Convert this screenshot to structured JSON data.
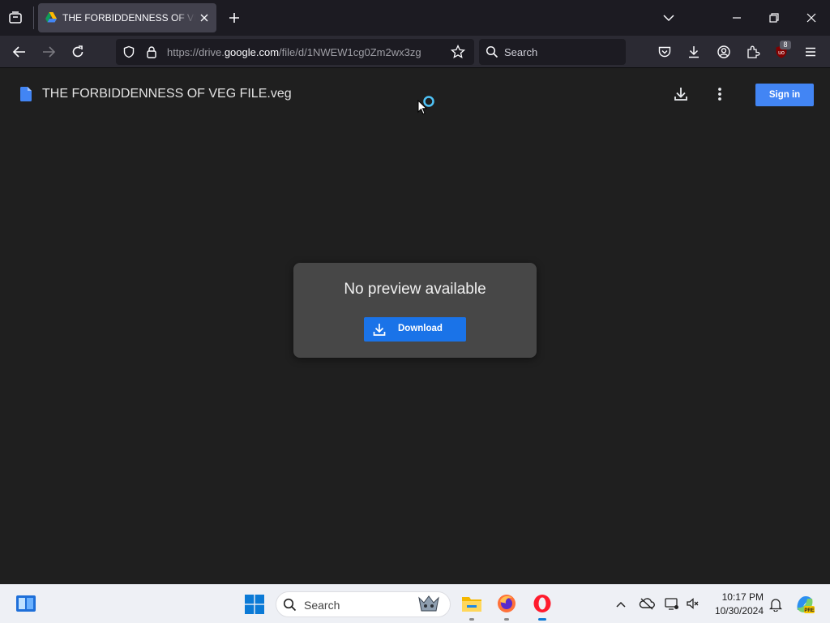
{
  "browser": {
    "tab_title": "THE FORBIDDENNESS OF VEG FILE.veg",
    "url_prefix": "https://drive.",
    "url_host": "google.com",
    "url_rest": "/file/d/1NWEW1cg0Zm2wx3zg",
    "search_placeholder": "Search",
    "extension_badge_count": "8"
  },
  "drive": {
    "file_title": "THE FORBIDDENNESS OF VEG FILE.veg",
    "sign_in_label": "Sign in",
    "no_preview_text": "No preview available",
    "download_label": "Download"
  },
  "taskbar": {
    "search_placeholder": "Search",
    "time": "10:17 PM",
    "date": "10/30/2024"
  },
  "colors": {
    "page_bg": "#1f1f1f",
    "accent_blue": "#1a73e8",
    "signin_blue": "#4285f4",
    "card_bg": "#474747"
  },
  "icons": [
    "tab-overview-icon",
    "google-drive-icon",
    "close-tab-icon",
    "new-tab-icon",
    "list-all-tabs-icon",
    "minimize-icon",
    "restore-icon",
    "close-window-icon",
    "back-icon",
    "forward-icon",
    "reload-icon",
    "shield-icon",
    "lock-icon",
    "bookmark-star-icon",
    "search-icon",
    "pocket-icon",
    "downloads-icon",
    "account-icon",
    "extensions-icon",
    "ublock-icon",
    "menu-icon",
    "doc-file-icon",
    "download-icon",
    "more-vert-icon",
    "widgets-icon",
    "windows-start-icon",
    "file-explorer-icon",
    "firefox-icon",
    "opera-icon",
    "chevron-up-icon",
    "onedrive-icon",
    "network-icon",
    "volume-muted-icon",
    "bell-icon",
    "copilot-icon"
  ]
}
